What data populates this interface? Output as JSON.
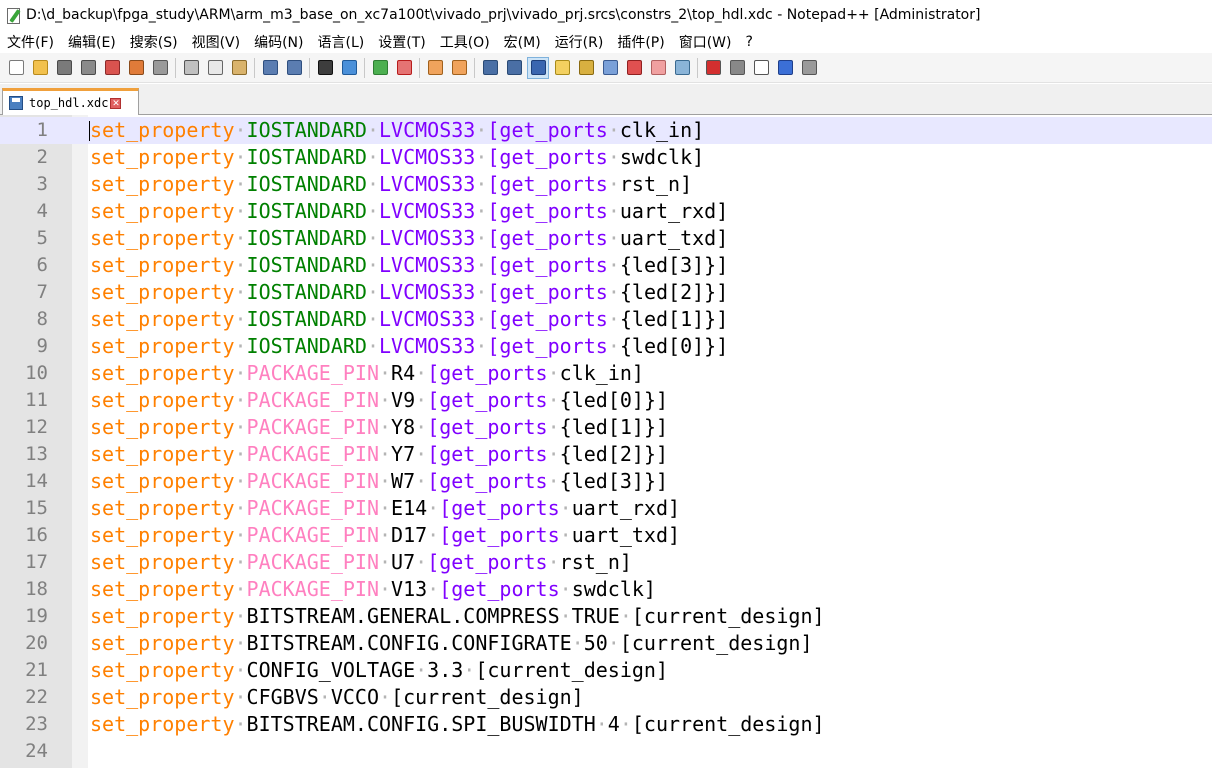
{
  "window": {
    "title": "D:\\d_backup\\fpga_study\\ARM\\arm_m3_base_on_xc7a100t\\vivado_prj\\vivado_prj.srcs\\constrs_2\\top_hdl.xdc - Notepad++ [Administrator]",
    "app_icon": "notepad-pencil-icon"
  },
  "menu": [
    {
      "label": "文件(F)"
    },
    {
      "label": "编辑(E)"
    },
    {
      "label": "搜索(S)"
    },
    {
      "label": "视图(V)"
    },
    {
      "label": "编码(N)"
    },
    {
      "label": "语言(L)"
    },
    {
      "label": "设置(T)"
    },
    {
      "label": "工具(O)"
    },
    {
      "label": "宏(M)"
    },
    {
      "label": "运行(R)"
    },
    {
      "label": "插件(P)"
    },
    {
      "label": "窗口(W)"
    },
    {
      "label": "?"
    }
  ],
  "toolbar": [
    {
      "icon": "new-file-icon",
      "color": "#ffffff",
      "border": "#7a7a7a"
    },
    {
      "icon": "open-folder-icon",
      "color": "#f2c14e",
      "border": "#b88a1c"
    },
    {
      "icon": "save-icon",
      "color": "#7a7a7a",
      "border": "#4a4a4a"
    },
    {
      "icon": "save-all-icon",
      "color": "#8a8a8a",
      "border": "#4a4a4a"
    },
    {
      "icon": "close-icon",
      "color": "#d9534f",
      "border": "#8a2a2a"
    },
    {
      "icon": "close-all-icon",
      "color": "#e07b39",
      "border": "#8a4a1a"
    },
    {
      "icon": "print-icon",
      "color": "#9a9a9a",
      "border": "#555555"
    },
    {
      "sep": true
    },
    {
      "icon": "cut-icon",
      "color": "#c0c0c0",
      "border": "#555555"
    },
    {
      "icon": "copy-icon",
      "color": "#e8e8e8",
      "border": "#666666"
    },
    {
      "icon": "paste-icon",
      "color": "#d9b36c",
      "border": "#8a6a2a"
    },
    {
      "sep": true
    },
    {
      "icon": "undo-icon",
      "color": "#5b7db1",
      "border": "#2f4f7f"
    },
    {
      "icon": "redo-icon",
      "color": "#5b7db1",
      "border": "#2f4f7f"
    },
    {
      "sep": true
    },
    {
      "icon": "find-icon",
      "color": "#3d3d3d",
      "border": "#111111"
    },
    {
      "icon": "replace-icon",
      "color": "#4a90d9",
      "border": "#1f5a99"
    },
    {
      "sep": true
    },
    {
      "icon": "zoom-in-icon",
      "color": "#4caf50",
      "border": "#2e7d32"
    },
    {
      "icon": "zoom-out-icon",
      "color": "#e57373",
      "border": "#b71c1c"
    },
    {
      "sep": true
    },
    {
      "icon": "sync-vertical-icon",
      "color": "#f0a35c",
      "border": "#a0601c"
    },
    {
      "icon": "sync-horizontal-icon",
      "color": "#f0a35c",
      "border": "#a0601c"
    },
    {
      "sep": true
    },
    {
      "icon": "word-wrap-icon",
      "color": "#4a6fa5",
      "border": "#2a4a75"
    },
    {
      "icon": "show-all-chars-icon",
      "color": "#4a6fa5",
      "border": "#2a4a75"
    },
    {
      "icon": "indent-guide-icon",
      "color": "#3a66b0",
      "border": "#1e3f7a",
      "active": true
    },
    {
      "icon": "user-lang-icon",
      "color": "#f3d060",
      "border": "#a88a1a"
    },
    {
      "icon": "doc-map-icon",
      "color": "#d8b040",
      "border": "#8a6a10"
    },
    {
      "icon": "function-list-icon",
      "color": "#7aa0d8",
      "border": "#3a5a90"
    },
    {
      "icon": "folder-as-workspace-icon",
      "color": "#e05050",
      "border": "#902020"
    },
    {
      "icon": "doc-list-icon",
      "color": "#f0a0a0",
      "border": "#b06060"
    },
    {
      "icon": "monitor-icon",
      "color": "#8ab4d8",
      "border": "#3a6a90"
    },
    {
      "sep": true
    },
    {
      "icon": "record-macro-icon",
      "color": "#d32f2f",
      "border": "#555555"
    },
    {
      "icon": "stop-record-icon",
      "color": "#888888",
      "border": "#555555"
    },
    {
      "icon": "play-macro-icon",
      "color": "#ffffff",
      "border": "#555555"
    },
    {
      "icon": "run-macro-multiple-icon",
      "color": "#3b6fd6",
      "border": "#1f3f8a"
    },
    {
      "icon": "save-macro-icon",
      "color": "#9a9a9a",
      "border": "#555555"
    }
  ],
  "tab": {
    "label": "top_hdl.xdc",
    "icon": "save-icon",
    "close_icon": "close-icon"
  },
  "editor": {
    "current_line": 1,
    "lines": [
      {
        "n": "1",
        "tokens": [
          [
            "set_property",
            "kw"
          ],
          [
            "IOSTANDARD",
            "prop-io"
          ],
          [
            "LVCMOS33",
            "val-io"
          ],
          [
            "[get_ports",
            "cmd"
          ],
          [
            "clk_in]",
            "plain"
          ]
        ]
      },
      {
        "n": "2",
        "tokens": [
          [
            "set_property",
            "kw"
          ],
          [
            "IOSTANDARD",
            "prop-io"
          ],
          [
            "LVCMOS33",
            "val-io"
          ],
          [
            "[get_ports",
            "cmd"
          ],
          [
            "swdclk]",
            "plain"
          ]
        ]
      },
      {
        "n": "3",
        "tokens": [
          [
            "set_property",
            "kw"
          ],
          [
            "IOSTANDARD",
            "prop-io"
          ],
          [
            "LVCMOS33",
            "val-io"
          ],
          [
            "[get_ports",
            "cmd"
          ],
          [
            "rst_n]",
            "plain"
          ]
        ]
      },
      {
        "n": "4",
        "tokens": [
          [
            "set_property",
            "kw"
          ],
          [
            "IOSTANDARD",
            "prop-io"
          ],
          [
            "LVCMOS33",
            "val-io"
          ],
          [
            "[get_ports",
            "cmd"
          ],
          [
            "uart_rxd]",
            "plain"
          ]
        ]
      },
      {
        "n": "5",
        "tokens": [
          [
            "set_property",
            "kw"
          ],
          [
            "IOSTANDARD",
            "prop-io"
          ],
          [
            "LVCMOS33",
            "val-io"
          ],
          [
            "[get_ports",
            "cmd"
          ],
          [
            "uart_txd]",
            "plain"
          ]
        ]
      },
      {
        "n": "6",
        "tokens": [
          [
            "set_property",
            "kw"
          ],
          [
            "IOSTANDARD",
            "prop-io"
          ],
          [
            "LVCMOS33",
            "val-io"
          ],
          [
            "[get_ports",
            "cmd"
          ],
          [
            "{led[3]}]",
            "plain"
          ]
        ]
      },
      {
        "n": "7",
        "tokens": [
          [
            "set_property",
            "kw"
          ],
          [
            "IOSTANDARD",
            "prop-io"
          ],
          [
            "LVCMOS33",
            "val-io"
          ],
          [
            "[get_ports",
            "cmd"
          ],
          [
            "{led[2]}]",
            "plain"
          ]
        ]
      },
      {
        "n": "8",
        "tokens": [
          [
            "set_property",
            "kw"
          ],
          [
            "IOSTANDARD",
            "prop-io"
          ],
          [
            "LVCMOS33",
            "val-io"
          ],
          [
            "[get_ports",
            "cmd"
          ],
          [
            "{led[1]}]",
            "plain"
          ]
        ]
      },
      {
        "n": "9",
        "tokens": [
          [
            "set_property",
            "kw"
          ],
          [
            "IOSTANDARD",
            "prop-io"
          ],
          [
            "LVCMOS33",
            "val-io"
          ],
          [
            "[get_ports",
            "cmd"
          ],
          [
            "{led[0]}]",
            "plain"
          ]
        ]
      },
      {
        "n": "10",
        "tokens": [
          [
            "set_property",
            "kw"
          ],
          [
            "PACKAGE_PIN",
            "prop-pkg"
          ],
          [
            "R4",
            "plain"
          ],
          [
            "[get_ports",
            "cmd"
          ],
          [
            "clk_in]",
            "plain"
          ]
        ]
      },
      {
        "n": "11",
        "tokens": [
          [
            "set_property",
            "kw"
          ],
          [
            "PACKAGE_PIN",
            "prop-pkg"
          ],
          [
            "V9",
            "plain"
          ],
          [
            "[get_ports",
            "cmd"
          ],
          [
            "{led[0]}]",
            "plain"
          ]
        ]
      },
      {
        "n": "12",
        "tokens": [
          [
            "set_property",
            "kw"
          ],
          [
            "PACKAGE_PIN",
            "prop-pkg"
          ],
          [
            "Y8",
            "plain"
          ],
          [
            "[get_ports",
            "cmd"
          ],
          [
            "{led[1]}]",
            "plain"
          ]
        ]
      },
      {
        "n": "13",
        "tokens": [
          [
            "set_property",
            "kw"
          ],
          [
            "PACKAGE_PIN",
            "prop-pkg"
          ],
          [
            "Y7",
            "plain"
          ],
          [
            "[get_ports",
            "cmd"
          ],
          [
            "{led[2]}]",
            "plain"
          ]
        ]
      },
      {
        "n": "14",
        "tokens": [
          [
            "set_property",
            "kw"
          ],
          [
            "PACKAGE_PIN",
            "prop-pkg"
          ],
          [
            "W7",
            "plain"
          ],
          [
            "[get_ports",
            "cmd"
          ],
          [
            "{led[3]}]",
            "plain"
          ]
        ]
      },
      {
        "n": "15",
        "tokens": [
          [
            "set_property",
            "kw"
          ],
          [
            "PACKAGE_PIN",
            "prop-pkg"
          ],
          [
            "E14",
            "plain"
          ],
          [
            "[get_ports",
            "cmd"
          ],
          [
            "uart_rxd]",
            "plain"
          ]
        ]
      },
      {
        "n": "16",
        "tokens": [
          [
            "set_property",
            "kw"
          ],
          [
            "PACKAGE_PIN",
            "prop-pkg"
          ],
          [
            "D17",
            "plain"
          ],
          [
            "[get_ports",
            "cmd"
          ],
          [
            "uart_txd]",
            "plain"
          ]
        ]
      },
      {
        "n": "17",
        "tokens": [
          [
            "set_property",
            "kw"
          ],
          [
            "PACKAGE_PIN",
            "prop-pkg"
          ],
          [
            "U7",
            "plain"
          ],
          [
            "[get_ports",
            "cmd"
          ],
          [
            "rst_n]",
            "plain"
          ]
        ]
      },
      {
        "n": "18",
        "tokens": [
          [
            "set_property",
            "kw"
          ],
          [
            "PACKAGE_PIN",
            "prop-pkg"
          ],
          [
            "V13",
            "plain"
          ],
          [
            "[get_ports",
            "cmd"
          ],
          [
            "swdclk]",
            "plain"
          ]
        ]
      },
      {
        "n": "19",
        "tokens": [
          [
            "set_property",
            "kw"
          ],
          [
            "BITSTREAM.GENERAL.COMPRESS",
            "plain"
          ],
          [
            "TRUE",
            "plain"
          ],
          [
            "[current_design]",
            "plain"
          ]
        ]
      },
      {
        "n": "20",
        "tokens": [
          [
            "set_property",
            "kw"
          ],
          [
            "BITSTREAM.CONFIG.CONFIGRATE",
            "plain"
          ],
          [
            "50",
            "plain"
          ],
          [
            "[current_design]",
            "plain"
          ]
        ]
      },
      {
        "n": "21",
        "tokens": [
          [
            "set_property",
            "kw"
          ],
          [
            "CONFIG_VOLTAGE",
            "plain"
          ],
          [
            "3.3",
            "plain"
          ],
          [
            "[current_design]",
            "plain"
          ]
        ]
      },
      {
        "n": "22",
        "tokens": [
          [
            "set_property",
            "kw"
          ],
          [
            "CFGBVS",
            "plain"
          ],
          [
            "VCCO",
            "plain"
          ],
          [
            "[current_design]",
            "plain"
          ]
        ]
      },
      {
        "n": "23",
        "tokens": [
          [
            "set_property",
            "kw"
          ],
          [
            "BITSTREAM.CONFIG.SPI_BUSWIDTH",
            "plain"
          ],
          [
            "4",
            "plain"
          ],
          [
            "[current_design]",
            "plain"
          ]
        ]
      },
      {
        "n": "24",
        "tokens": []
      }
    ]
  }
}
